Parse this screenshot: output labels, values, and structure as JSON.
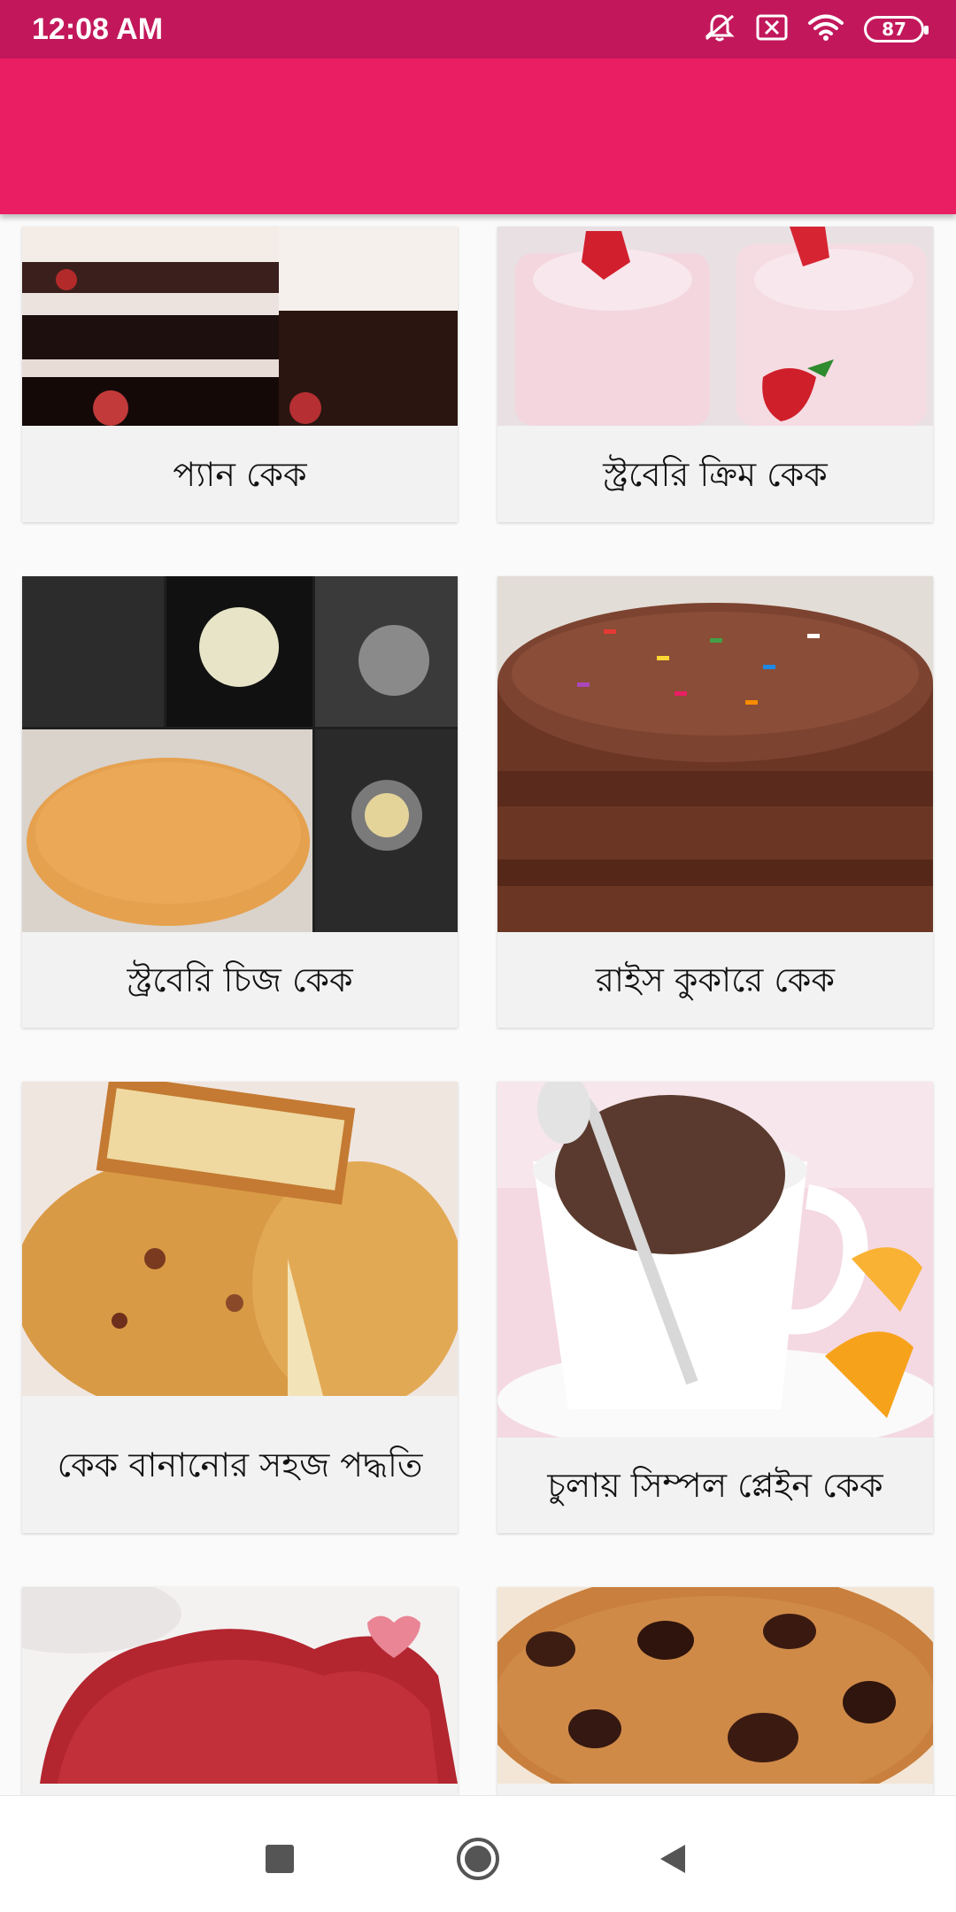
{
  "status_bar": {
    "time": "12:08 AM",
    "battery": "87",
    "icons": [
      "muted-bell-icon",
      "close-box-icon",
      "wifi-icon",
      "battery-icon"
    ]
  },
  "app_bar": {
    "color": "#e91e63"
  },
  "recipes": [
    {
      "title": "প্যান কেক",
      "image": "layered-cake-photo"
    },
    {
      "title": "স্ট্রবেরি ক্রিম কেক",
      "image": "strawberry-mousse-photo"
    },
    {
      "title": "স্ট্রবেরি চিজ কেক",
      "image": "cake-steps-collage-photo"
    },
    {
      "title": "রাইস কুকারে কেক",
      "image": "chocolate-sprinkle-cake-photo"
    },
    {
      "title": "কেক বানানোর সহজ পদ্ধতি",
      "image": "pound-cake-photo"
    },
    {
      "title": "চুলায় সিম্পল প্লেইন কেক",
      "image": "mug-cake-photo"
    },
    {
      "title": "",
      "image": "red-velvet-heart-photo"
    },
    {
      "title": "",
      "image": "chocolate-chip-cake-photo"
    }
  ],
  "nav_bar": {
    "icons": [
      "recent-apps-icon",
      "home-icon",
      "back-icon"
    ]
  },
  "colors": {
    "status_bar": "#c2185b",
    "app_bar": "#e91e63",
    "card_bg": "#f2f2f2"
  }
}
